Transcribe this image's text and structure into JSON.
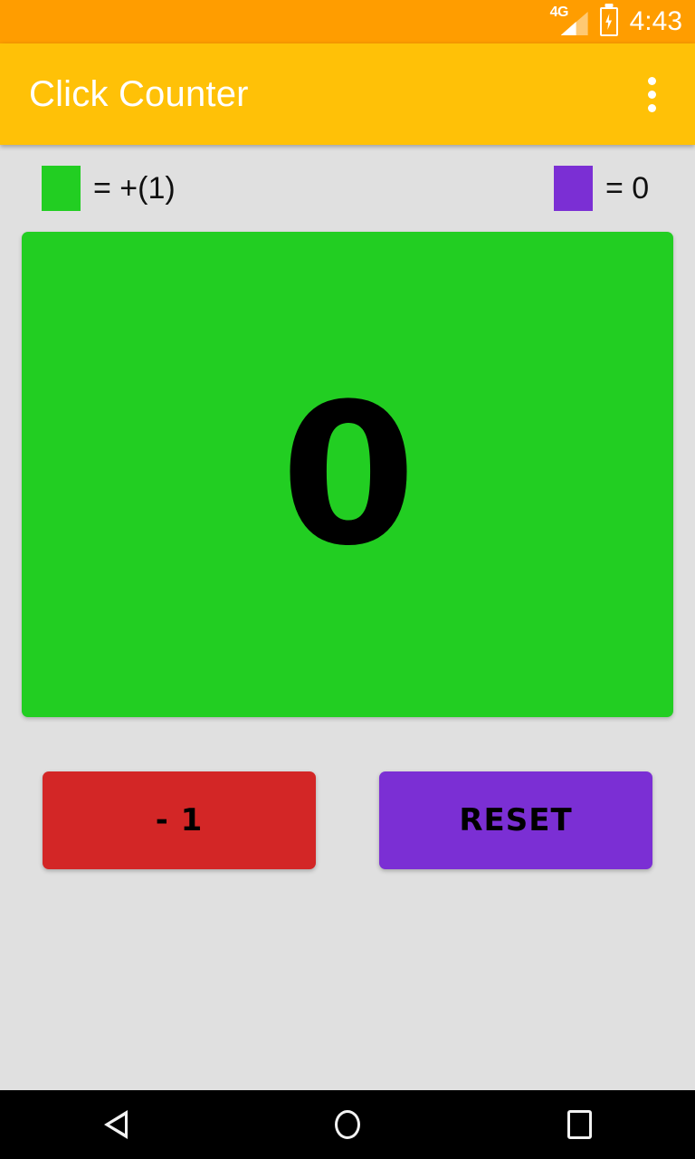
{
  "status_bar": {
    "network_label": "4G",
    "time": "4:43",
    "background_color": "#FF9D00",
    "icons": [
      "signal-4g-icon",
      "battery-charging-icon"
    ]
  },
  "app_bar": {
    "title": "Click Counter",
    "background_color": "#FFC107",
    "title_color": "#FFFFFF",
    "overflow_icon": "more-vert-icon"
  },
  "content": {
    "background_color": "#E0E0E0",
    "legend": [
      {
        "key": "increment",
        "swatch_color": "#22CE22",
        "label": "= +(1)"
      },
      {
        "key": "reset",
        "swatch_color": "#7B2FD4",
        "label": "= 0"
      }
    ],
    "counter": {
      "value": "0",
      "background_color": "#22CE22",
      "text_color": "#000000"
    },
    "buttons": [
      {
        "key": "decrement",
        "label": "- 1",
        "color": "#D32626",
        "text_color": "#000000"
      },
      {
        "key": "reset",
        "label": "RESET",
        "color": "#7B2FD4",
        "text_color": "#000000"
      }
    ]
  },
  "nav_bar": {
    "background_color": "#000000",
    "buttons": [
      "back-icon",
      "home-icon",
      "recents-icon"
    ]
  }
}
